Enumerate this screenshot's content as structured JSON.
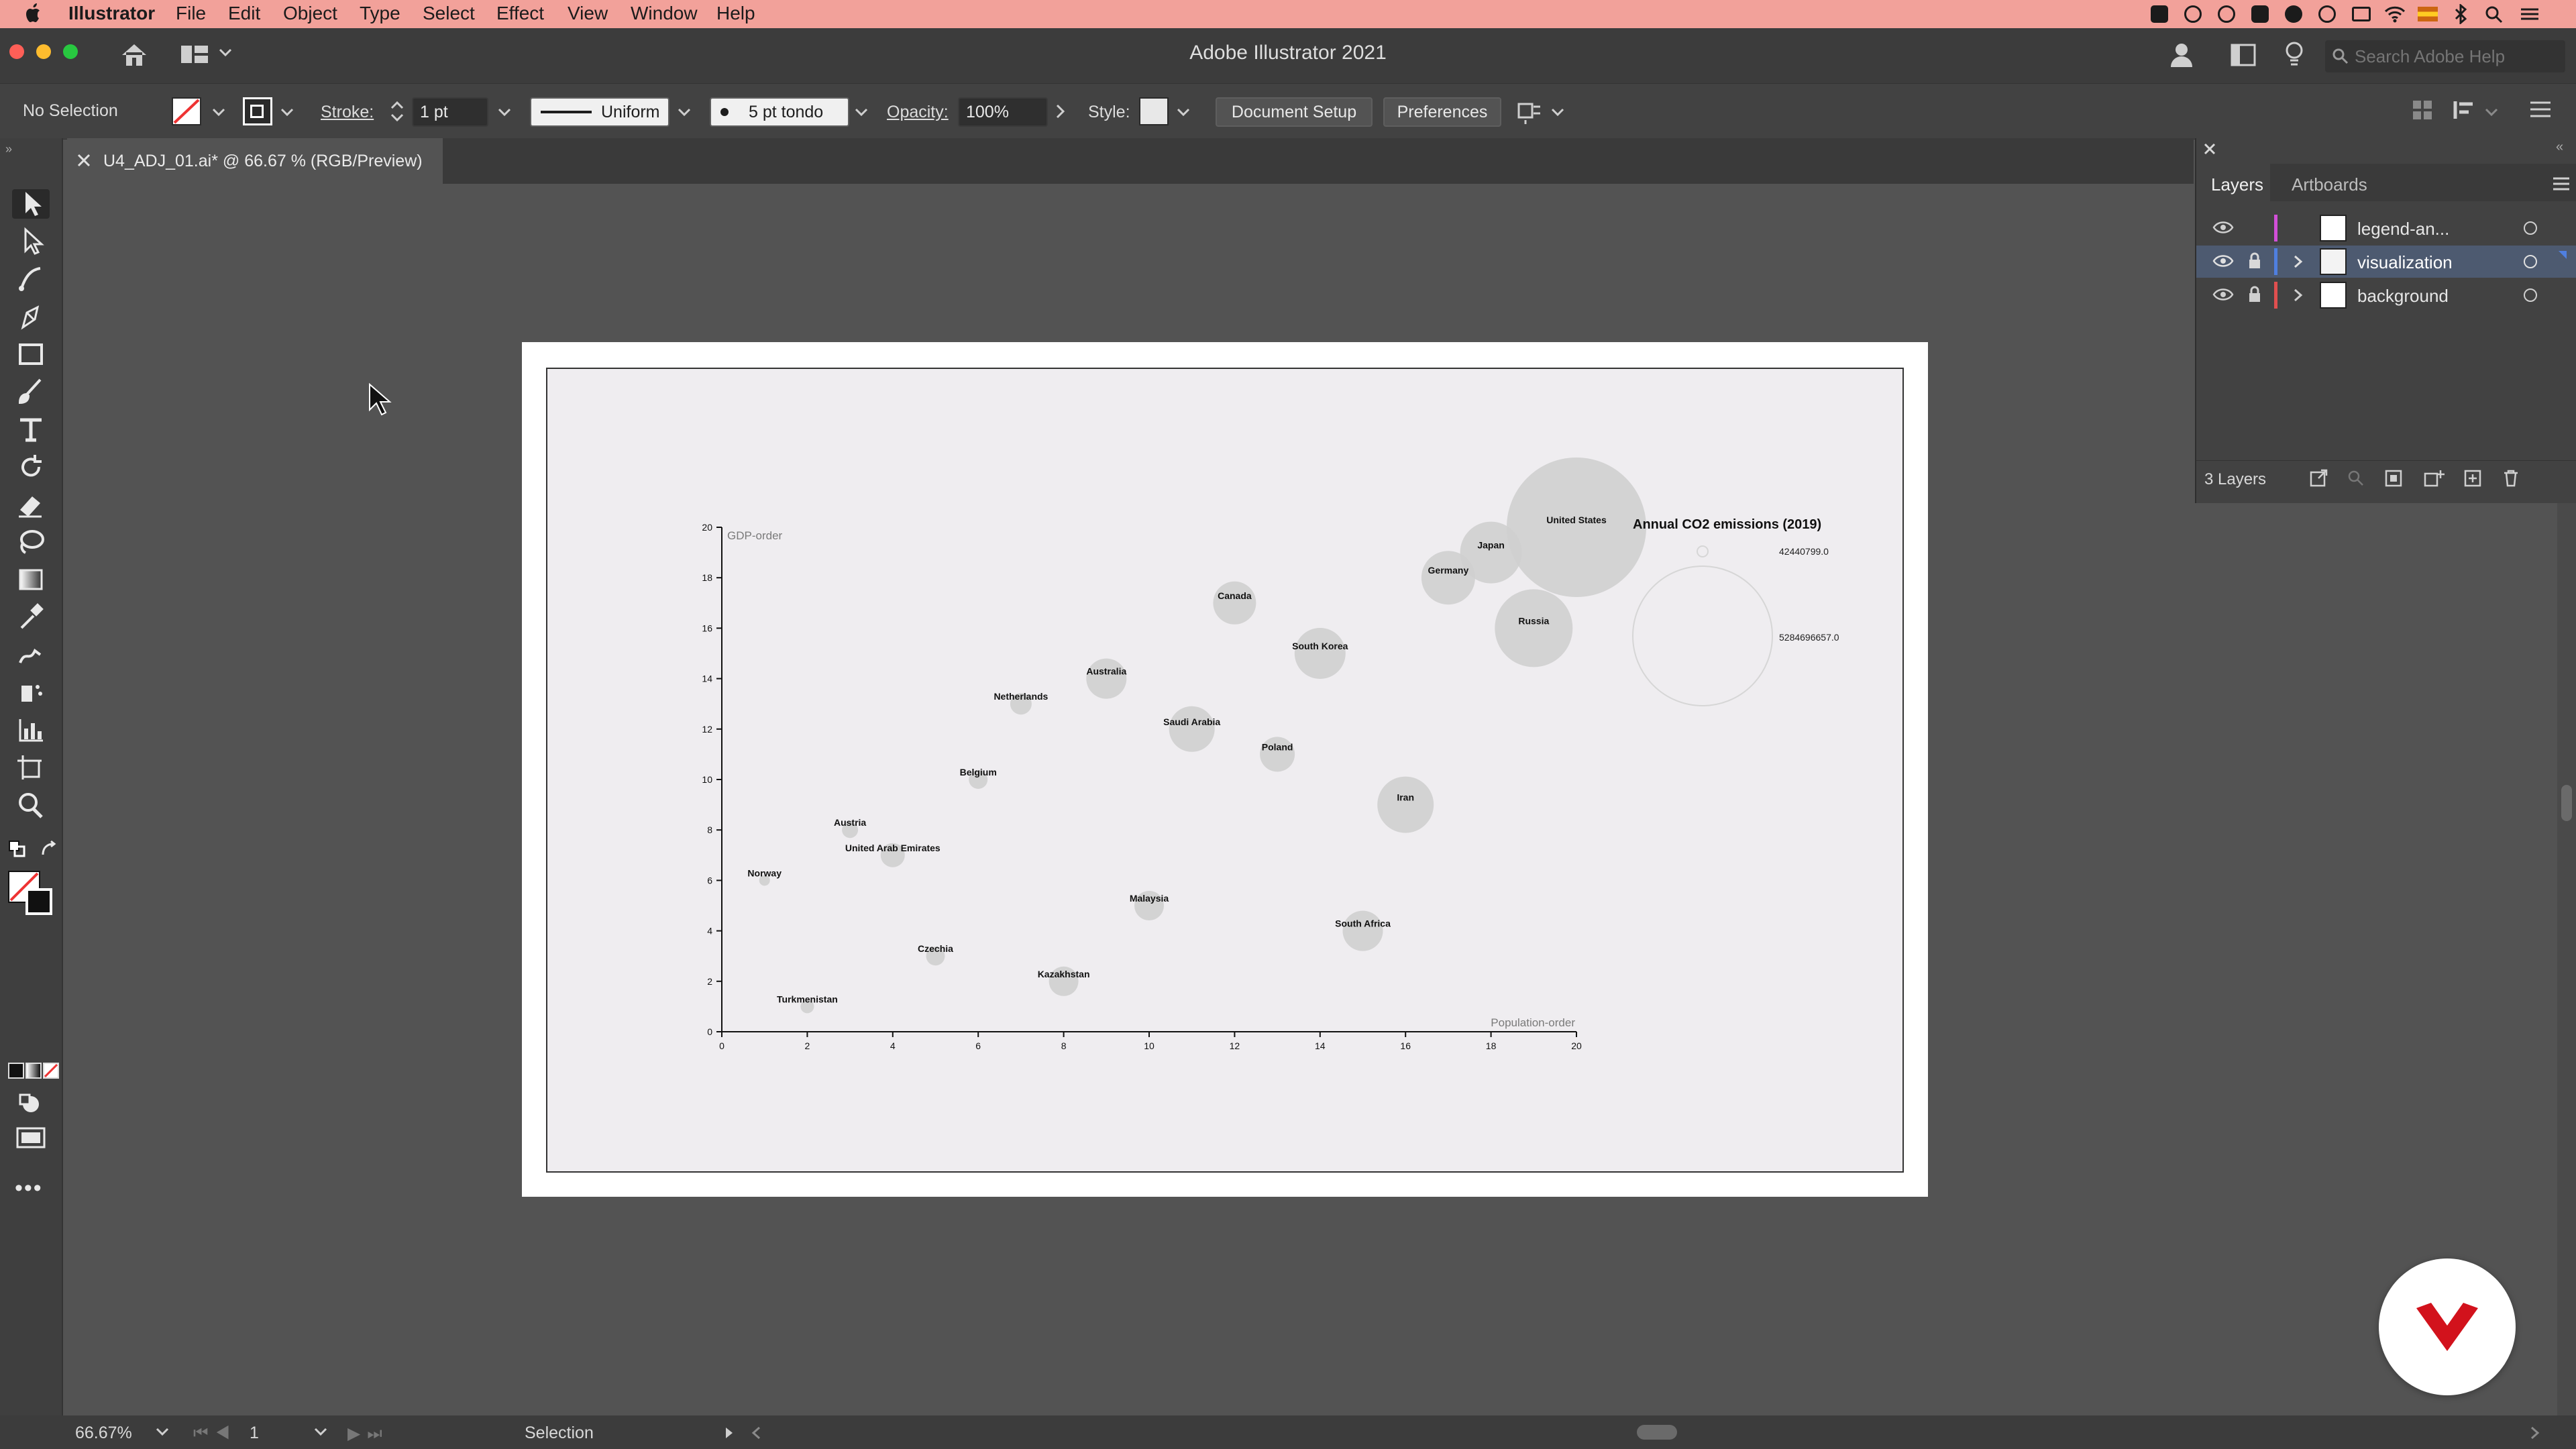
{
  "menubar": {
    "app": "Illustrator",
    "items": [
      "File",
      "Edit",
      "Object",
      "Type",
      "Select",
      "Effect",
      "View",
      "Window",
      "Help"
    ]
  },
  "titlebar": {
    "title": "Adobe Illustrator 2021",
    "search_placeholder": "Search Adobe Help"
  },
  "control_bar": {
    "selection": "No Selection",
    "stroke_label": "Stroke:",
    "stroke_value": "1 pt",
    "stroke_profile": "Uniform",
    "brush": "5 pt tondo",
    "opacity_label": "Opacity:",
    "opacity_value": "100%",
    "style_label": "Style:",
    "document_setup": "Document Setup",
    "preferences": "Preferences"
  },
  "document_tab": {
    "title": "U4_ADJ_01.ai* @ 66.67 % (RGB/Preview)"
  },
  "layers_panel": {
    "tabs": [
      "Layers",
      "Artboards"
    ],
    "layers": [
      {
        "name": "legend-an...",
        "color": "#d24fd8",
        "locked": false,
        "selected": false
      },
      {
        "name": "visualization",
        "color": "#4f7fe0",
        "locked": true,
        "selected": true
      },
      {
        "name": "background",
        "color": "#e04f4f",
        "locked": true,
        "selected": false
      }
    ],
    "count": "3 Layers"
  },
  "status_bar": {
    "zoom": "66.67%",
    "artboard": "1",
    "tool": "Selection"
  },
  "chart_data": {
    "type": "scatter",
    "xlabel": "Population-order",
    "ylabel": "GDP-order",
    "xlim": [
      0,
      20
    ],
    "ylim": [
      0,
      20
    ],
    "xticks": [
      0,
      2,
      4,
      6,
      8,
      10,
      12,
      14,
      16,
      18,
      20
    ],
    "yticks": [
      0,
      2,
      4,
      6,
      8,
      10,
      12,
      14,
      16,
      18,
      20
    ],
    "points": [
      {
        "label": "Turkmenistan",
        "x": 2,
        "y": 1,
        "r": 10
      },
      {
        "label": "Kazakhstan",
        "x": 8,
        "y": 2,
        "r": 22
      },
      {
        "label": "Czechia",
        "x": 5,
        "y": 3,
        "r": 14
      },
      {
        "label": "South Africa",
        "x": 15,
        "y": 4,
        "r": 30
      },
      {
        "label": "Malaysia",
        "x": 10,
        "y": 5,
        "r": 22
      },
      {
        "label": "Norway",
        "x": 1,
        "y": 6,
        "r": 8
      },
      {
        "label": "United Arab Emirates",
        "x": 4,
        "y": 7,
        "r": 18
      },
      {
        "label": "Austria",
        "x": 3,
        "y": 8,
        "r": 12
      },
      {
        "label": "Iran",
        "x": 16,
        "y": 9,
        "r": 42
      },
      {
        "label": "Belgium",
        "x": 6,
        "y": 10,
        "r": 14
      },
      {
        "label": "Poland",
        "x": 13,
        "y": 11,
        "r": 26
      },
      {
        "label": "Saudi Arabia",
        "x": 11,
        "y": 12,
        "r": 34
      },
      {
        "label": "Netherlands",
        "x": 7,
        "y": 13,
        "r": 16
      },
      {
        "label": "Australia",
        "x": 9,
        "y": 14,
        "r": 30
      },
      {
        "label": "South Korea",
        "x": 14,
        "y": 15,
        "r": 38
      },
      {
        "label": "Russia",
        "x": 19,
        "y": 16,
        "r": 58
      },
      {
        "label": "Canada",
        "x": 12,
        "y": 17,
        "r": 32
      },
      {
        "label": "Germany",
        "x": 17,
        "y": 18,
        "r": 40
      },
      {
        "label": "Japan",
        "x": 18,
        "y": 19,
        "r": 46
      },
      {
        "label": "United States",
        "x": 20,
        "y": 20,
        "r": 104
      }
    ],
    "legend": {
      "title": "Annual CO2 emissions (2019)",
      "entries": [
        "42440799.0",
        "5284696657.0"
      ]
    }
  }
}
